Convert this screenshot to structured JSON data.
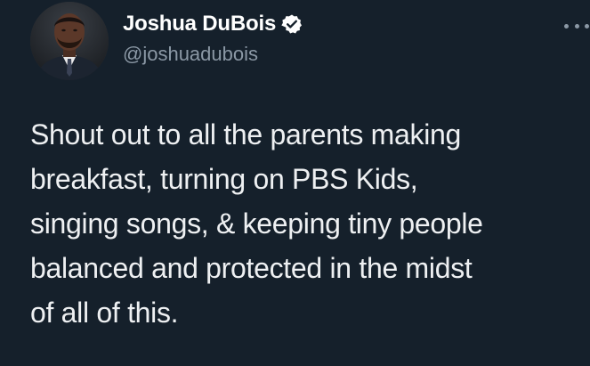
{
  "author": {
    "display_name": "Joshua DuBois",
    "handle": "@joshuadubois",
    "verified": true,
    "avatar_icon": "profile-photo"
  },
  "more_menu_icon": "more-horizontal-icon",
  "tweet": {
    "lines": [
      "Shout out to all the parents making",
      "breakfast, turning on PBS Kids,",
      "singing songs, & keeping tiny people",
      "balanced and protected in the midst",
      "of all of this."
    ]
  },
  "colors": {
    "background": "#15202b",
    "text": "#e7e9ea",
    "secondary_text": "#8b98a5",
    "verified_badge": "#ffffff"
  }
}
